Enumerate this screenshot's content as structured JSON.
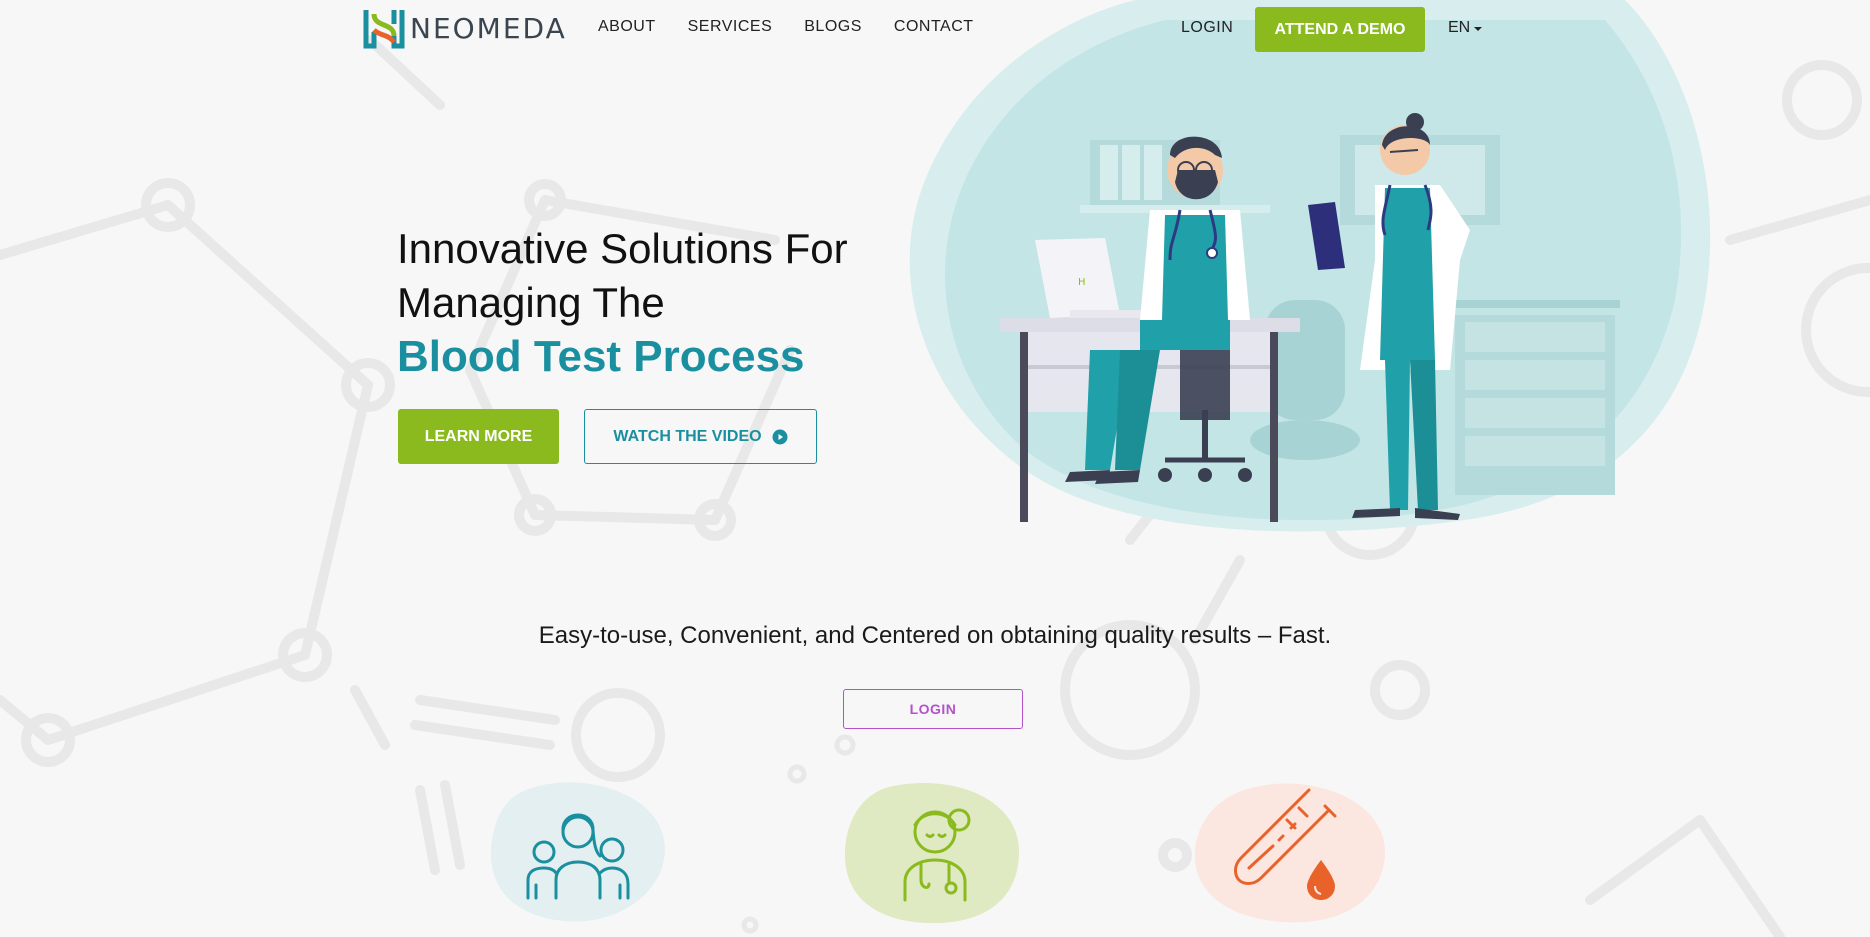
{
  "brand": {
    "name": "NEOMEDA",
    "logo_icon": "neomeda-h-logo-icon"
  },
  "nav": {
    "items": [
      {
        "label": "ABOUT"
      },
      {
        "label": "SERVICES"
      },
      {
        "label": "BLOGS"
      },
      {
        "label": "CONTACT"
      }
    ],
    "login_label": "LOGIN",
    "demo_label": "ATTEND A DEMO",
    "language": "EN"
  },
  "hero": {
    "title_line1": "Innovative Solutions For",
    "title_line2": "Managing The",
    "title_accent": "Blood Test Process",
    "learn_more_label": "LEARN MORE",
    "watch_video_label": "WATCH THE VIDEO"
  },
  "section": {
    "tagline": "Easy-to-use, Convenient, and Centered on obtaining quality results – Fast.",
    "login_label": "LOGIN"
  },
  "features": [
    {
      "icon": "patients-group-icon"
    },
    {
      "icon": "nurse-icon"
    },
    {
      "icon": "blood-test-tube-icon"
    }
  ],
  "colors": {
    "accent_green": "#8aba1e",
    "accent_teal": "#1a8fa0",
    "accent_purple": "#b453c9",
    "blob": "#c4e5e6",
    "background": "#f7f7f7"
  }
}
